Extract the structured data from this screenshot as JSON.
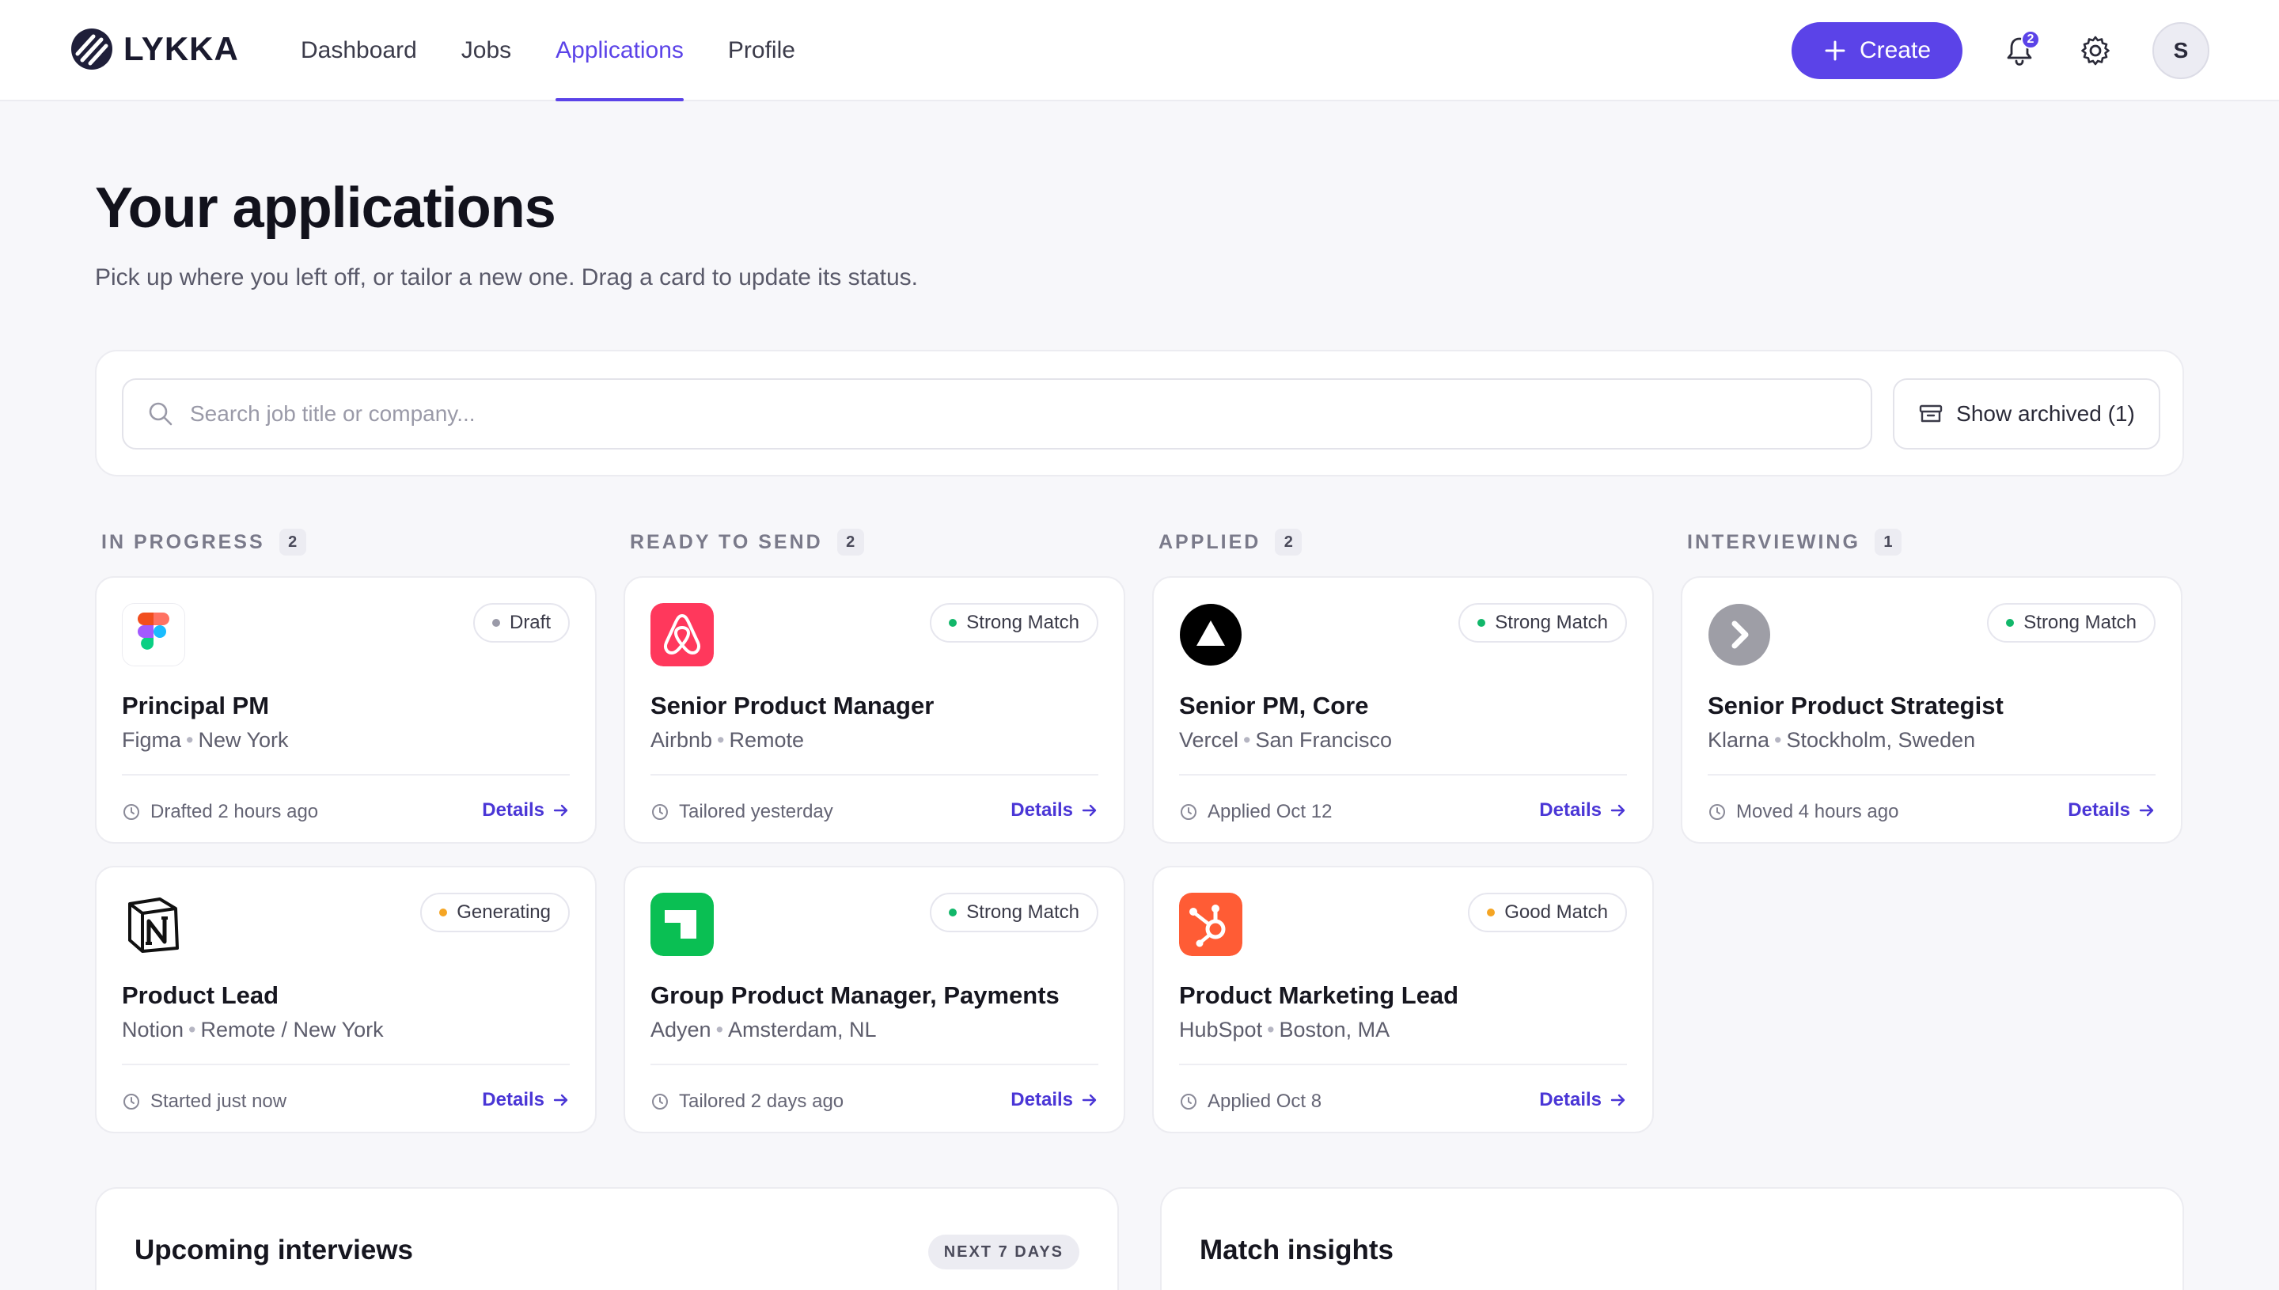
{
  "brand": {
    "name": "LYKKA"
  },
  "nav": {
    "items": [
      {
        "label": "Dashboard",
        "active": false
      },
      {
        "label": "Jobs",
        "active": false
      },
      {
        "label": "Applications",
        "active": true
      },
      {
        "label": "Profile",
        "active": false
      }
    ]
  },
  "topbar": {
    "create_label": "Create",
    "notifications_count": "2",
    "avatar_initial": "S"
  },
  "header": {
    "title": "Your applications",
    "subtitle": "Pick up where you left off, or tailor a new one. Drag a card to update its status."
  },
  "search": {
    "placeholder": "Search job title or company...",
    "value": "",
    "archived_label": "Show archived (1)"
  },
  "colors": {
    "accent": "#5b43e8",
    "link": "#4a36d6",
    "status_green": "#12b76a",
    "status_amber": "#f5a524",
    "status_gray": "#9a9aa8"
  },
  "columns": [
    {
      "title": "IN PROGRESS",
      "count": "2",
      "cards": [
        {
          "logo": "figma-logo",
          "status": "Draft",
          "status_color": "#9a9aa8",
          "title": "Principal PM",
          "company": "Figma",
          "location": "New York",
          "activity": "Drafted 2 hours ago",
          "details_label": "Details"
        },
        {
          "logo": "notion-logo",
          "status": "Generating",
          "status_color": "#f5a524",
          "title": "Product Lead",
          "company": "Notion",
          "location": "Remote / New York",
          "activity": "Started just now",
          "details_label": "Details"
        }
      ]
    },
    {
      "title": "READY TO SEND",
      "count": "2",
      "cards": [
        {
          "logo": "airbnb-logo",
          "status": "Strong Match",
          "status_color": "#12b76a",
          "title": "Senior Product Manager",
          "company": "Airbnb",
          "location": "Remote",
          "activity": "Tailored yesterday",
          "details_label": "Details"
        },
        {
          "logo": "adyen-logo",
          "status": "Strong Match",
          "status_color": "#12b76a",
          "title": "Group Product Manager, Payments",
          "company": "Adyen",
          "location": "Amsterdam, NL",
          "activity": "Tailored 2 days ago",
          "details_label": "Details"
        }
      ]
    },
    {
      "title": "APPLIED",
      "count": "2",
      "cards": [
        {
          "logo": "vercel-logo",
          "status": "Strong Match",
          "status_color": "#12b76a",
          "title": "Senior PM, Core",
          "company": "Vercel",
          "location": "San Francisco",
          "activity": "Applied Oct 12",
          "details_label": "Details"
        },
        {
          "logo": "hubspot-logo",
          "status": "Good Match",
          "status_color": "#f5a524",
          "title": "Product Marketing Lead",
          "company": "HubSpot",
          "location": "Boston, MA",
          "activity": "Applied Oct 8",
          "details_label": "Details"
        }
      ]
    },
    {
      "title": "INTERVIEWING",
      "count": "1",
      "cards": [
        {
          "logo": "klarna-logo",
          "status": "Strong Match",
          "status_color": "#12b76a",
          "title": "Senior Product Strategist",
          "company": "Klarna",
          "location": "Stockholm, Sweden",
          "activity": "Moved 4 hours ago",
          "details_label": "Details"
        }
      ]
    }
  ],
  "panels": {
    "upcoming": {
      "title": "Upcoming interviews",
      "tag": "NEXT 7 DAYS"
    },
    "insights": {
      "title": "Match insights"
    }
  }
}
